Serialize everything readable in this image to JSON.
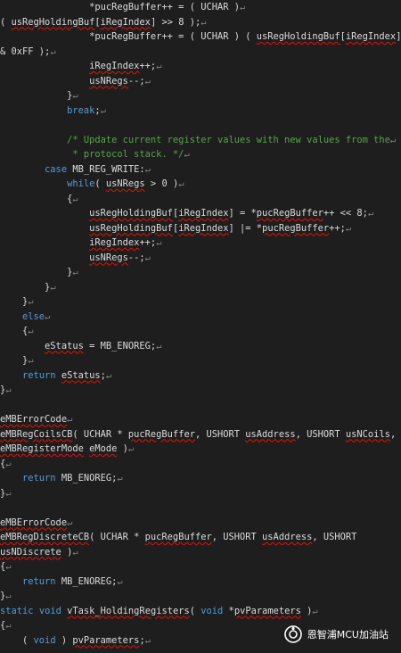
{
  "editor": {
    "lines": [
      {
        "i": 0,
        "t": [
          {
            "c": "tx",
            "s": "                *pucRegBuffer++ = ( UCHAR )"
          }
        ],
        "p": true
      },
      {
        "i": 0,
        "t": [
          {
            "c": "tx",
            "s": "( "
          },
          {
            "c": "tx sq",
            "s": "usRegHoldingBuf"
          },
          {
            "c": "tx",
            "s": "["
          },
          {
            "c": "tx sq",
            "s": "iRegIndex"
          },
          {
            "c": "tx",
            "s": "] >> 8 );"
          }
        ],
        "p": true
      },
      {
        "i": 0,
        "t": [
          {
            "c": "tx",
            "s": "                *pucRegBuffer++ = ( UCHAR ) ( "
          },
          {
            "c": "tx sq",
            "s": "usRegHoldingBuf"
          },
          {
            "c": "tx",
            "s": "["
          },
          {
            "c": "tx sq",
            "s": "iRegIndex"
          },
          {
            "c": "tx",
            "s": "]"
          }
        ],
        "p": true
      },
      {
        "i": 0,
        "t": [
          {
            "c": "tx",
            "s": "& 0xFF );"
          }
        ],
        "p": true
      },
      {
        "i": 0,
        "t": [
          {
            "c": "tx",
            "s": "                "
          },
          {
            "c": "tx sq",
            "s": "iRegIndex"
          },
          {
            "c": "tx",
            "s": "++;"
          }
        ],
        "p": true
      },
      {
        "i": 0,
        "t": [
          {
            "c": "tx",
            "s": "                "
          },
          {
            "c": "tx sq",
            "s": "usNRegs"
          },
          {
            "c": "tx",
            "s": "--;"
          }
        ],
        "p": true
      },
      {
        "i": 0,
        "t": [
          {
            "c": "tx",
            "s": "            }"
          }
        ],
        "p": true
      },
      {
        "i": 0,
        "t": [
          {
            "c": "tx",
            "s": "            "
          },
          {
            "c": "kw",
            "s": "break"
          },
          {
            "c": "tx",
            "s": ";"
          }
        ],
        "p": true
      },
      {
        "i": 0,
        "t": [
          {
            "c": "tx",
            "s": ""
          }
        ],
        "p": false
      },
      {
        "i": 0,
        "t": [
          {
            "c": "cm",
            "s": "            /* Update current register values with new values from the"
          }
        ],
        "p": true
      },
      {
        "i": 0,
        "t": [
          {
            "c": "cm",
            "s": "             * protocol stack. */"
          }
        ],
        "p": true
      },
      {
        "i": 0,
        "t": [
          {
            "c": "tx",
            "s": "        "
          },
          {
            "c": "kw",
            "s": "case"
          },
          {
            "c": "tx",
            "s": " MB_REG_WRITE:"
          }
        ],
        "p": true
      },
      {
        "i": 0,
        "t": [
          {
            "c": "tx",
            "s": "            "
          },
          {
            "c": "kw",
            "s": "while"
          },
          {
            "c": "tx",
            "s": "( "
          },
          {
            "c": "tx sq",
            "s": "usNRegs"
          },
          {
            "c": "tx",
            "s": " > 0 )"
          }
        ],
        "p": true
      },
      {
        "i": 0,
        "t": [
          {
            "c": "tx",
            "s": "            {"
          }
        ],
        "p": true
      },
      {
        "i": 0,
        "t": [
          {
            "c": "tx",
            "s": "                "
          },
          {
            "c": "tx sq",
            "s": "usRegHoldingBuf"
          },
          {
            "c": "tx",
            "s": "["
          },
          {
            "c": "tx sq",
            "s": "iRegIndex"
          },
          {
            "c": "tx",
            "s": "] = *"
          },
          {
            "c": "tx sq",
            "s": "pucRegBuffer"
          },
          {
            "c": "tx",
            "s": "++ << 8;"
          }
        ],
        "p": true
      },
      {
        "i": 0,
        "t": [
          {
            "c": "tx",
            "s": "                "
          },
          {
            "c": "tx sq",
            "s": "usRegHoldingBuf"
          },
          {
            "c": "tx",
            "s": "["
          },
          {
            "c": "tx sq",
            "s": "iRegIndex"
          },
          {
            "c": "tx",
            "s": "] |= *"
          },
          {
            "c": "tx sq",
            "s": "pucRegBuffer"
          },
          {
            "c": "tx",
            "s": "++;"
          }
        ],
        "p": true
      },
      {
        "i": 0,
        "t": [
          {
            "c": "tx",
            "s": "                "
          },
          {
            "c": "tx sq",
            "s": "iRegIndex"
          },
          {
            "c": "tx",
            "s": "++;"
          }
        ],
        "p": true
      },
      {
        "i": 0,
        "t": [
          {
            "c": "tx",
            "s": "                "
          },
          {
            "c": "tx sq",
            "s": "usNRegs"
          },
          {
            "c": "tx",
            "s": "--;"
          }
        ],
        "p": true
      },
      {
        "i": 0,
        "t": [
          {
            "c": "tx",
            "s": "            }"
          }
        ],
        "p": true
      },
      {
        "i": 0,
        "t": [
          {
            "c": "tx",
            "s": "        }"
          }
        ],
        "p": true
      },
      {
        "i": 0,
        "t": [
          {
            "c": "tx",
            "s": "    }"
          }
        ],
        "p": true
      },
      {
        "i": 0,
        "t": [
          {
            "c": "tx",
            "s": "    "
          },
          {
            "c": "kw",
            "s": "else"
          }
        ],
        "p": true
      },
      {
        "i": 0,
        "t": [
          {
            "c": "tx",
            "s": "    {"
          }
        ],
        "p": true
      },
      {
        "i": 0,
        "t": [
          {
            "c": "tx",
            "s": "        "
          },
          {
            "c": "tx sq",
            "s": "eStatus"
          },
          {
            "c": "tx",
            "s": " = MB_ENOREG;"
          }
        ],
        "p": true
      },
      {
        "i": 0,
        "t": [
          {
            "c": "tx",
            "s": "    }"
          }
        ],
        "p": true
      },
      {
        "i": 0,
        "t": [
          {
            "c": "tx",
            "s": "    "
          },
          {
            "c": "kw",
            "s": "return"
          },
          {
            "c": "tx",
            "s": " "
          },
          {
            "c": "tx sq",
            "s": "eStatus"
          },
          {
            "c": "tx",
            "s": ";"
          }
        ],
        "p": true
      },
      {
        "i": 0,
        "t": [
          {
            "c": "tx",
            "s": "}"
          }
        ],
        "p": true
      },
      {
        "i": 0,
        "t": [
          {
            "c": "tx",
            "s": ""
          }
        ],
        "p": false
      },
      {
        "i": 0,
        "t": [
          {
            "c": "tx sq",
            "s": "eMBErrorCode"
          }
        ],
        "p": true
      },
      {
        "i": 0,
        "t": [
          {
            "c": "tx sq",
            "s": "eMBRegCoilsCB"
          },
          {
            "c": "tx",
            "s": "( UCHAR * "
          },
          {
            "c": "tx sq",
            "s": "pucRegBuffer"
          },
          {
            "c": "tx",
            "s": ", USHORT "
          },
          {
            "c": "tx sq",
            "s": "usAddress"
          },
          {
            "c": "tx",
            "s": ", USHORT "
          },
          {
            "c": "tx sq",
            "s": "usNCoils"
          },
          {
            "c": "tx",
            "s": ","
          }
        ],
        "p": false
      },
      {
        "i": 0,
        "t": [
          {
            "c": "tx sq",
            "s": "eMBRegisterMode"
          },
          {
            "c": "tx",
            "s": " "
          },
          {
            "c": "tx sq",
            "s": "eMode"
          },
          {
            "c": "tx",
            "s": " )"
          }
        ],
        "p": true
      },
      {
        "i": 0,
        "t": [
          {
            "c": "tx",
            "s": "{"
          }
        ],
        "p": true
      },
      {
        "i": 0,
        "t": [
          {
            "c": "tx",
            "s": "    "
          },
          {
            "c": "kw",
            "s": "return"
          },
          {
            "c": "tx",
            "s": " MB_ENOREG;"
          }
        ],
        "p": true
      },
      {
        "i": 0,
        "t": [
          {
            "c": "tx",
            "s": "}"
          }
        ],
        "p": true
      },
      {
        "i": 0,
        "t": [
          {
            "c": "tx",
            "s": ""
          }
        ],
        "p": false
      },
      {
        "i": 0,
        "t": [
          {
            "c": "tx sq",
            "s": "eMBErrorCode"
          }
        ],
        "p": true
      },
      {
        "i": 0,
        "t": [
          {
            "c": "tx sq",
            "s": "eMBRegDiscreteCB"
          },
          {
            "c": "tx",
            "s": "( UCHAR * "
          },
          {
            "c": "tx sq",
            "s": "pucRegBuffer"
          },
          {
            "c": "tx",
            "s": ", USHORT "
          },
          {
            "c": "tx sq",
            "s": "usAddress"
          },
          {
            "c": "tx",
            "s": ", USHORT"
          }
        ],
        "p": false
      },
      {
        "i": 0,
        "t": [
          {
            "c": "tx sq",
            "s": "usNDiscrete"
          },
          {
            "c": "tx",
            "s": " )"
          }
        ],
        "p": true
      },
      {
        "i": 0,
        "t": [
          {
            "c": "tx",
            "s": "{"
          }
        ],
        "p": true
      },
      {
        "i": 0,
        "t": [
          {
            "c": "tx",
            "s": "    "
          },
          {
            "c": "kw",
            "s": "return"
          },
          {
            "c": "tx",
            "s": " MB_ENOREG;"
          }
        ],
        "p": true
      },
      {
        "i": 0,
        "t": [
          {
            "c": "tx",
            "s": "}"
          }
        ],
        "p": true
      },
      {
        "i": 0,
        "t": [
          {
            "c": "kw",
            "s": "static"
          },
          {
            "c": "tx",
            "s": " "
          },
          {
            "c": "kw",
            "s": "void"
          },
          {
            "c": "tx",
            "s": " "
          },
          {
            "c": "tx sq",
            "s": "vTask_HoldingRegisters"
          },
          {
            "c": "tx",
            "s": "( "
          },
          {
            "c": "kw",
            "s": "void"
          },
          {
            "c": "tx",
            "s": " *"
          },
          {
            "c": "tx sq",
            "s": "pvParameters"
          },
          {
            "c": "tx",
            "s": " )"
          }
        ],
        "p": true
      },
      {
        "i": 0,
        "t": [
          {
            "c": "tx",
            "s": "{"
          }
        ],
        "p": true
      },
      {
        "i": 0,
        "t": [
          {
            "c": "tx",
            "s": "    ( "
          },
          {
            "c": "kw",
            "s": "void"
          },
          {
            "c": "tx",
            "s": " ) "
          },
          {
            "c": "tx sq",
            "s": "pvParameters"
          },
          {
            "c": "tx",
            "s": ";"
          }
        ],
        "p": true
      }
    ],
    "paragraph_mark": "↵",
    "colors": {
      "background": "#1e1e1e",
      "text": "#dcdcdc",
      "keyword": "#569cd6",
      "comment": "#57a64a",
      "squiggle": "#e51400"
    }
  },
  "watermark": {
    "label": "恩智浦MCU加油站",
    "icon": "wechat-official-account-icon"
  }
}
